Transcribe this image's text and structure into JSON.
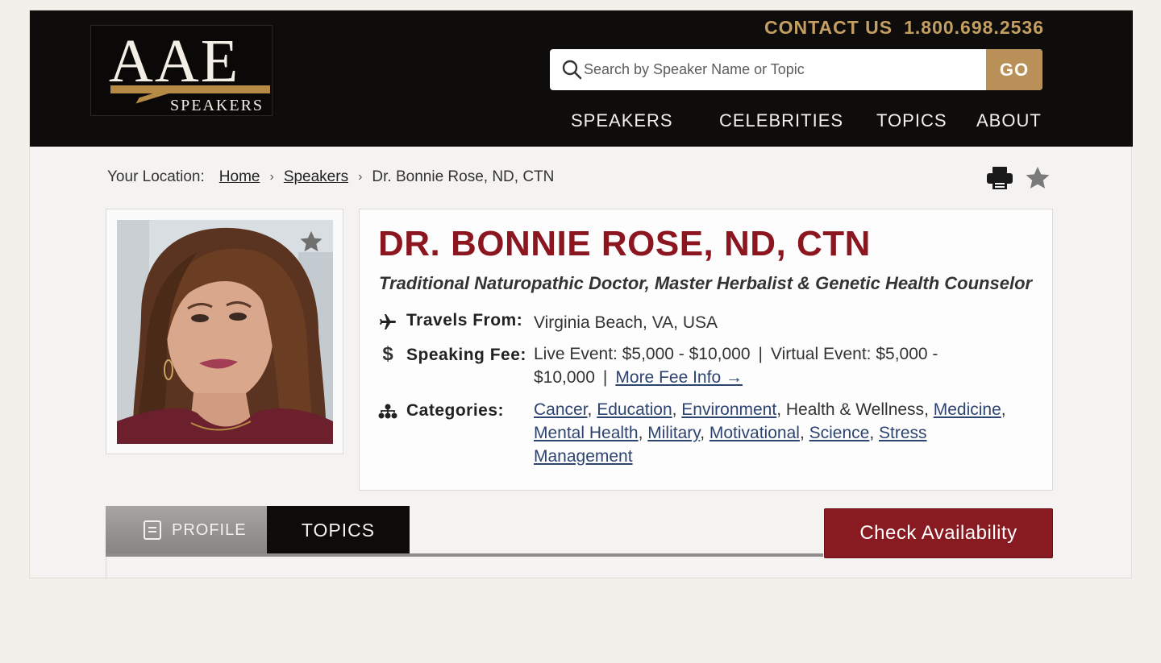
{
  "header": {
    "logo": {
      "main": "AAE",
      "sub": "SPEAKERS"
    },
    "contact_label": "CONTACT US",
    "phone": "1.800.698.2536",
    "search": {
      "placeholder": "Search by Speaker Name or Topic",
      "button": "GO"
    },
    "nav": [
      "SPEAKERS",
      "CELEBRITIES",
      "TOPICS",
      "ABOUT"
    ]
  },
  "breadcrumb": {
    "label": "Your Location:",
    "items": [
      "Home",
      "Speakers"
    ],
    "current": "Dr. Bonnie Rose, ND, CTN"
  },
  "speaker": {
    "name": "DR. BONNIE ROSE, ND, CTN",
    "tagline": "Traditional Naturopathic Doctor, Master Herbalist & Genetic Health Counselor",
    "travels_label": "Travels From:",
    "travels_value": "Virginia Beach, VA, USA",
    "fee_label": "Speaking Fee:",
    "fee_live": "Live Event: $5,000 - $10,000",
    "fee_virtual": "Virtual Event: $5,000 - $10,000",
    "fee_more": "More Fee Info →",
    "categories_label": "Categories:",
    "categories": [
      "Cancer",
      "Education",
      "Environment",
      "Health & Wellness",
      "Medicine",
      "Mental Health",
      "Military",
      "Motivational",
      "Science",
      "Stress Management"
    ],
    "categories_linked": [
      true,
      true,
      true,
      false,
      true,
      true,
      true,
      true,
      true,
      true
    ]
  },
  "tabs": {
    "profile": "PROFILE",
    "topics": "TOPICS"
  },
  "check_availability": "Check Availability",
  "colors": {
    "brand_red": "#8c1620",
    "gold": "#b99158",
    "header_bg": "#0f0d0c"
  }
}
